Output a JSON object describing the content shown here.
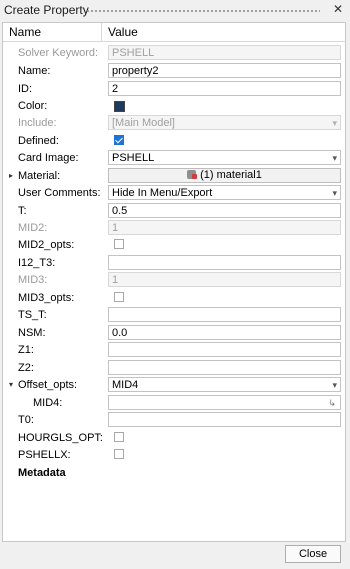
{
  "window": {
    "title": "Create Property",
    "close_glyph": "✕"
  },
  "table": {
    "col_name": "Name",
    "col_value": "Value"
  },
  "rows": {
    "solver_keyword": {
      "label": "Solver Keyword:",
      "value": "PSHELL"
    },
    "name": {
      "label": "Name:",
      "value": "property2"
    },
    "id": {
      "label": "ID:",
      "value": "2"
    },
    "color": {
      "label": "Color:",
      "swatch_color": "#1f3a5f"
    },
    "include": {
      "label": "Include:",
      "value": "[Main Model]"
    },
    "defined": {
      "label": "Defined:",
      "checked": true
    },
    "card_image": {
      "label": "Card Image:",
      "value": "PSHELL"
    },
    "material": {
      "label": "Material:",
      "value": "(1) material1"
    },
    "user_comments": {
      "label": "User Comments:",
      "value": "Hide In Menu/Export"
    },
    "t": {
      "label": "T:",
      "value": "0.5"
    },
    "mid2": {
      "label": "MID2:",
      "value": "1"
    },
    "mid2_opts": {
      "label": "MID2_opts:",
      "checked": false
    },
    "i12_t3": {
      "label": "I12_T3:",
      "value": ""
    },
    "mid3": {
      "label": "MID3:",
      "value": "1"
    },
    "mid3_opts": {
      "label": "MID3_opts:",
      "checked": false
    },
    "ts_t": {
      "label": "TS_T:",
      "value": ""
    },
    "nsm": {
      "label": "NSM:",
      "value": "0.0"
    },
    "z1": {
      "label": "Z1:",
      "value": ""
    },
    "z2": {
      "label": "Z2:",
      "value": ""
    },
    "offset_opts": {
      "label": "Offset_opts:",
      "value": "MID4"
    },
    "mid4": {
      "label": "MID4:",
      "value": ""
    },
    "t0": {
      "label": "T0:",
      "value": ""
    },
    "hourgls_opt": {
      "label": "HOURGLS_OPT:",
      "checked": false
    },
    "pshellx": {
      "label": "PSHELLX:",
      "checked": false
    },
    "metadata": {
      "label": "Metadata"
    }
  },
  "footer": {
    "close_label": "Close"
  },
  "colors": {
    "accent": "#1e73d8",
    "swatch": "#1f3a5f"
  }
}
